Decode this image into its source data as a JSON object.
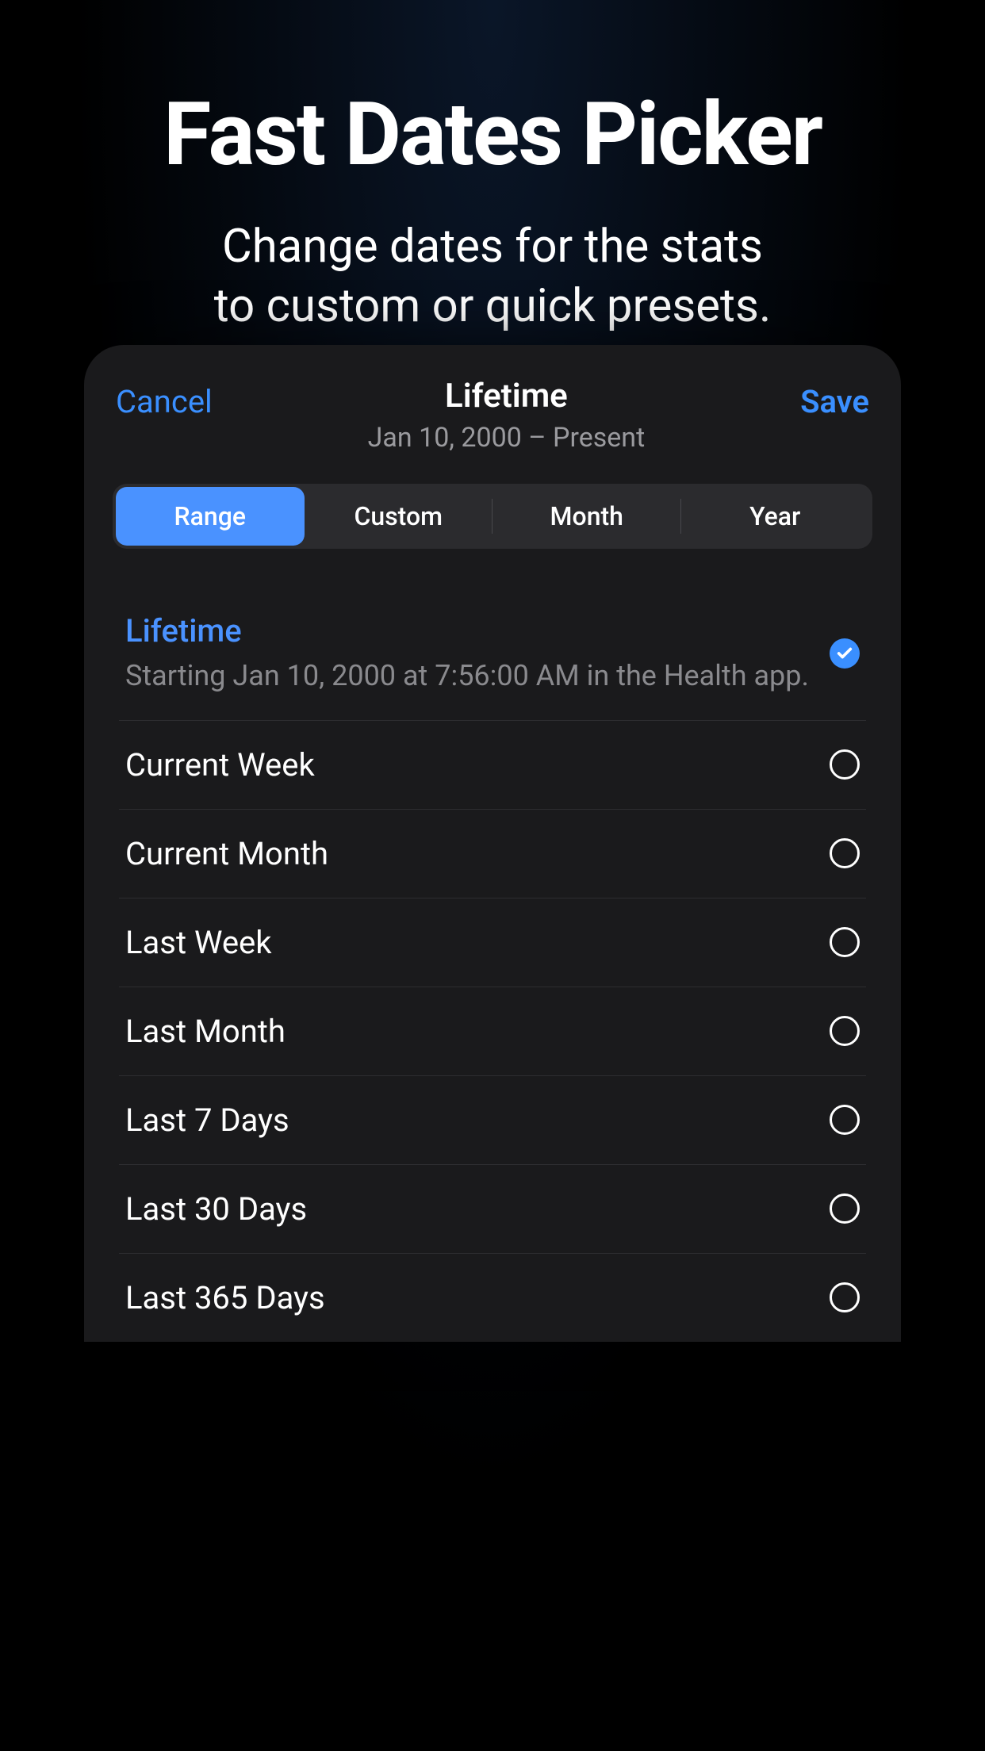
{
  "hero": {
    "title": "Fast Dates Picker",
    "subtitle_line1": "Change dates for the stats",
    "subtitle_line2": "to custom or quick presets."
  },
  "sheet": {
    "cancel_label": "Cancel",
    "save_label": "Save",
    "title": "Lifetime",
    "subtitle": "Jan 10, 2000 – Present"
  },
  "segments": {
    "range": "Range",
    "custom": "Custom",
    "month": "Month",
    "year": "Year"
  },
  "options": {
    "lifetime": {
      "label": "Lifetime",
      "detail": "Starting Jan 10, 2000 at 7:56:00 AM in the Health app."
    },
    "current_week": {
      "label": "Current Week"
    },
    "current_month": {
      "label": "Current Month"
    },
    "last_week": {
      "label": "Last Week"
    },
    "last_month": {
      "label": "Last Month"
    },
    "last_7_days": {
      "label": "Last 7 Days"
    },
    "last_30_days": {
      "label": "Last 30 Days"
    },
    "last_365_days": {
      "label": "Last 365 Days"
    }
  },
  "colors": {
    "accent": "#3a8fff",
    "segment_active": "#4a92ff"
  }
}
